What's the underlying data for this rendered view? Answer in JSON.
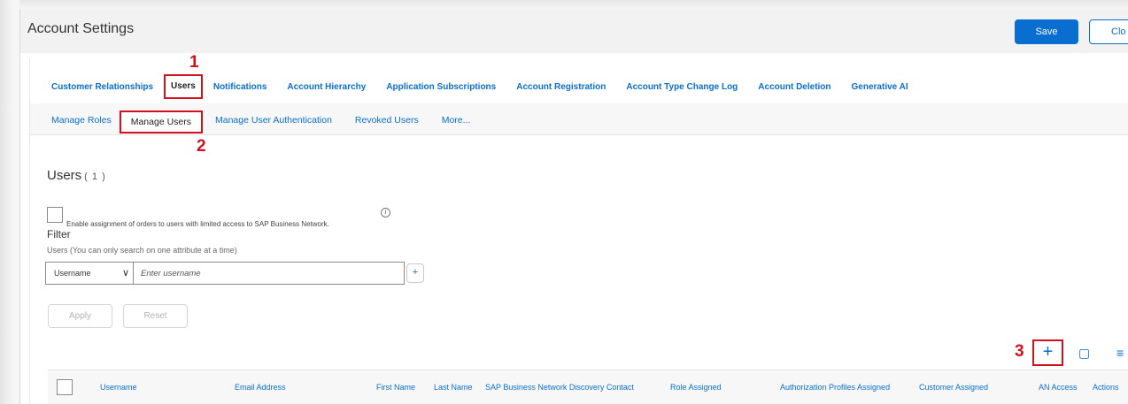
{
  "window": {
    "title": "Account Settings"
  },
  "actions": {
    "save": "Save",
    "close": "Clo"
  },
  "top_tabs": [
    "Customer Relationships",
    "Users",
    "Notifications",
    "Account Hierarchy",
    "Application Subscriptions",
    "Account Registration",
    "Account Type Change Log",
    "Account Deletion",
    "Generative AI"
  ],
  "sub_tabs": [
    "Manage Roles",
    "Manage Users",
    "Manage User Authentication",
    "Revoked Users",
    "More..."
  ],
  "annotations": {
    "step1": "1",
    "step2": "2",
    "step3": "3"
  },
  "users_section": {
    "title": "Users",
    "count": "( 1 )",
    "enable_text": "Enable assignment of orders to users with limited access to SAP Business Network.",
    "info_glyph": "i",
    "filter_label": "Filter",
    "filter_hint": "Users (You can only search on one attribute at a time)",
    "filter_select": "Username",
    "filter_placeholder": "Enter username",
    "add_filter": "+",
    "apply": "Apply",
    "reset": "Reset"
  },
  "toolbar": {
    "add": "+",
    "settings_glyph": "▢",
    "view_glyph": "≡"
  },
  "table": {
    "columns": [
      "Username",
      "Email Address",
      "First Name",
      "Last Name",
      "SAP Business Network Discovery Contact",
      "Role Assigned",
      "Authorization Profiles Assigned",
      "Customer Assigned",
      "AN Access",
      "Actions"
    ]
  },
  "colors": {
    "accent": "#0a6ed1",
    "highlight": "#d4101e"
  }
}
